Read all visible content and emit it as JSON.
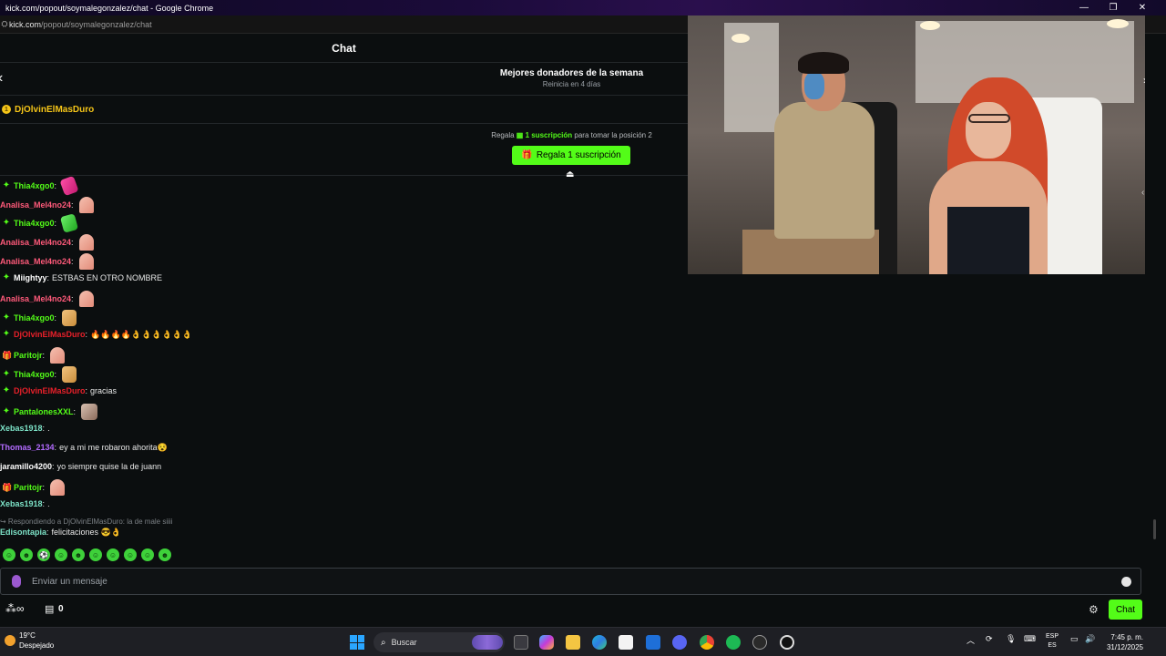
{
  "window": {
    "title": "kick.com/popout/soymalegonzalez/chat - Google Chrome",
    "minimize": "—",
    "maximize": "❐",
    "close": "✕"
  },
  "address": {
    "domain": "kick.com",
    "path": "/popout/soymalegonzalez/chat"
  },
  "chat": {
    "title": "Chat"
  },
  "leaderboard": {
    "title": "Mejores donadores de la semana",
    "subtitle": "Reinicia en 4 días",
    "top_donor": "DjOlvinElMasDuro",
    "gift_prefix": "Regala",
    "gift_highlight": "1 suscripción",
    "gift_suffix": "para tomar la posición 2",
    "gift_button": "Regala 1 suscripción"
  },
  "messages": [
    {
      "user": "Thia4xgo0",
      "color": "#53fc18",
      "badge": "✦",
      "text": "",
      "emote": "magenta"
    },
    {
      "user": "Analisa_Mel4no24",
      "color": "#ff5a7a",
      "badge": "",
      "text": "",
      "emote": "pink"
    },
    {
      "user": "Thia4xgo0",
      "color": "#53fc18",
      "badge": "✦",
      "text": "",
      "emote": "green"
    },
    {
      "user": "Analisa_Mel4no24",
      "color": "#ff5a7a",
      "badge": "",
      "text": "",
      "emote": "pink"
    },
    {
      "user": "Analisa_Mel4no24",
      "color": "#ff5a7a",
      "badge": "",
      "text": "",
      "emote": "pink"
    },
    {
      "user": "Miightyy",
      "color": "#ffffff",
      "badge": "✦",
      "text": "ESTBAS EN OTRO NOMBRE",
      "emote": ""
    },
    {
      "user": "Analisa_Mel4no24",
      "color": "#ff5a7a",
      "badge": "",
      "text": "",
      "emote": "pink"
    },
    {
      "user": "Thia4xgo0",
      "color": "#53fc18",
      "badge": "✦",
      "text": "",
      "emote": "hands"
    },
    {
      "user": "DjOlvinElMasDuro",
      "color": "#e8202a",
      "badge": "✦",
      "text": "🔥🔥🔥🔥👌👌👌👌👌👌",
      "emote": ""
    },
    {
      "user": "Paritojr",
      "color": "#53fc18",
      "badge": "🎁",
      "text": "",
      "emote": "pink"
    },
    {
      "user": "Thia4xgo0",
      "color": "#53fc18",
      "badge": "✦",
      "text": "",
      "emote": "hands"
    },
    {
      "user": "DjOlvinElMasDuro",
      "color": "#e8202a",
      "badge": "✦",
      "text": "gracias",
      "emote": ""
    },
    {
      "user": "PantalonesXXL",
      "color": "#53fc18",
      "badge": "✦",
      "text": "",
      "emote": "photo"
    },
    {
      "user": "Xebas1918",
      "color": "#7de3c8",
      "badge": "",
      "text": ".",
      "emote": ""
    },
    {
      "user": "Thomas_2134",
      "color": "#b36bff",
      "badge": "",
      "text": "ey a mi me robaron ahorita😵",
      "emote": ""
    },
    {
      "user": "jaramillo4200",
      "color": "#ffffff",
      "badge": "",
      "text": "yo siempre quise la de juann",
      "emote": ""
    },
    {
      "user": "Paritojr",
      "color": "#53fc18",
      "badge": "🎁",
      "text": "",
      "emote": "pink"
    },
    {
      "user": "Xebas1918",
      "color": "#7de3c8",
      "badge": "",
      "text": ".",
      "emote": ""
    }
  ],
  "reply": {
    "context": "↪ Respondiendo a DjOlvinElMasDuro: la de male siiii",
    "user": "Edisontapia",
    "color": "#7de3c8",
    "text": "felicitaciones 😎👌"
  },
  "emote_bar": [
    "☺",
    "☻",
    "⚽",
    "☺",
    "☻",
    "☺",
    "☺",
    "☺",
    "☺",
    "☻"
  ],
  "input": {
    "placeholder": "Enviar un mensaje"
  },
  "footer": {
    "infinity": "∞",
    "shop_count": "0",
    "send_label": "Chat"
  },
  "taskbar": {
    "temperature": "19°C",
    "condition": "Despejado",
    "search_label": "Buscar",
    "lang_top": "ESP",
    "lang_bottom": "ES",
    "time": "7:45 p. m.",
    "date": "31/12/2025"
  },
  "colors": {
    "accent": "#53fc18",
    "background": "#0b0e0f",
    "gold": "#f5c518"
  }
}
